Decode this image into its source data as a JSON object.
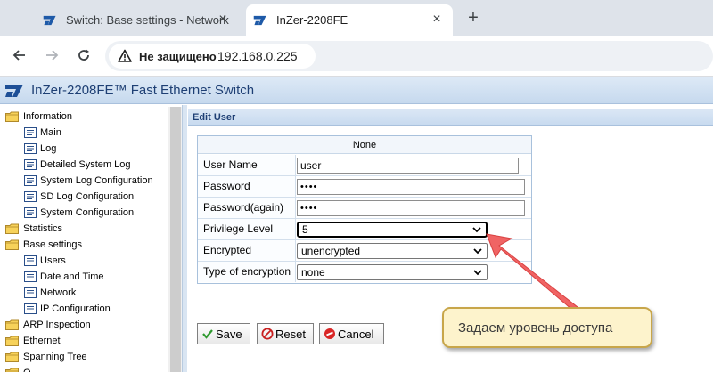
{
  "browser": {
    "tabs": [
      {
        "title": "Switch: Base settings - Network",
        "active": false
      },
      {
        "title": "InZer-2208FE",
        "active": true
      }
    ],
    "new_tab_symbol": "+",
    "security_label": "Не защищено",
    "url": "192.168.0.225"
  },
  "app": {
    "title": "InZer-2208FE™ Fast Ethernet Switch",
    "brand_color": "#1e3f74"
  },
  "sidebar": {
    "items": [
      {
        "label": "Information",
        "type": "folder"
      },
      {
        "label": "Main",
        "type": "page"
      },
      {
        "label": "Log",
        "type": "page"
      },
      {
        "label": "Detailed System Log",
        "type": "page"
      },
      {
        "label": "System Log Configuration",
        "type": "page"
      },
      {
        "label": "SD Log Configuration",
        "type": "page"
      },
      {
        "label": "System Configuration",
        "type": "page"
      },
      {
        "label": "Statistics",
        "type": "folder"
      },
      {
        "label": "Base settings",
        "type": "folder"
      },
      {
        "label": "Users",
        "type": "page"
      },
      {
        "label": "Date and Time",
        "type": "page"
      },
      {
        "label": "Network",
        "type": "page"
      },
      {
        "label": "IP Configuration",
        "type": "page"
      },
      {
        "label": "ARP Inspection",
        "type": "folder"
      },
      {
        "label": "Ethernet",
        "type": "folder"
      },
      {
        "label": "Spanning Tree",
        "type": "folder"
      },
      {
        "label": "Q",
        "type": "folder"
      }
    ]
  },
  "panel": {
    "title": "Edit User",
    "table_header": "None",
    "fields": {
      "user_name": {
        "label": "User Name",
        "value": "user"
      },
      "password": {
        "label": "Password",
        "value": "••••"
      },
      "password_again": {
        "label": "Password(again)",
        "value": "••••"
      },
      "privilege_level": {
        "label": "Privilege Level",
        "value": "5"
      },
      "encrypted": {
        "label": "Encrypted",
        "value": "unencrypted"
      },
      "type_of_encryption": {
        "label": "Type of encryption",
        "value": "none"
      }
    },
    "buttons": {
      "save": "Save",
      "reset": "Reset",
      "cancel": "Cancel"
    }
  },
  "callout": {
    "text": "Задаем уровень доступа",
    "arrow_color": "#f05a5a"
  }
}
